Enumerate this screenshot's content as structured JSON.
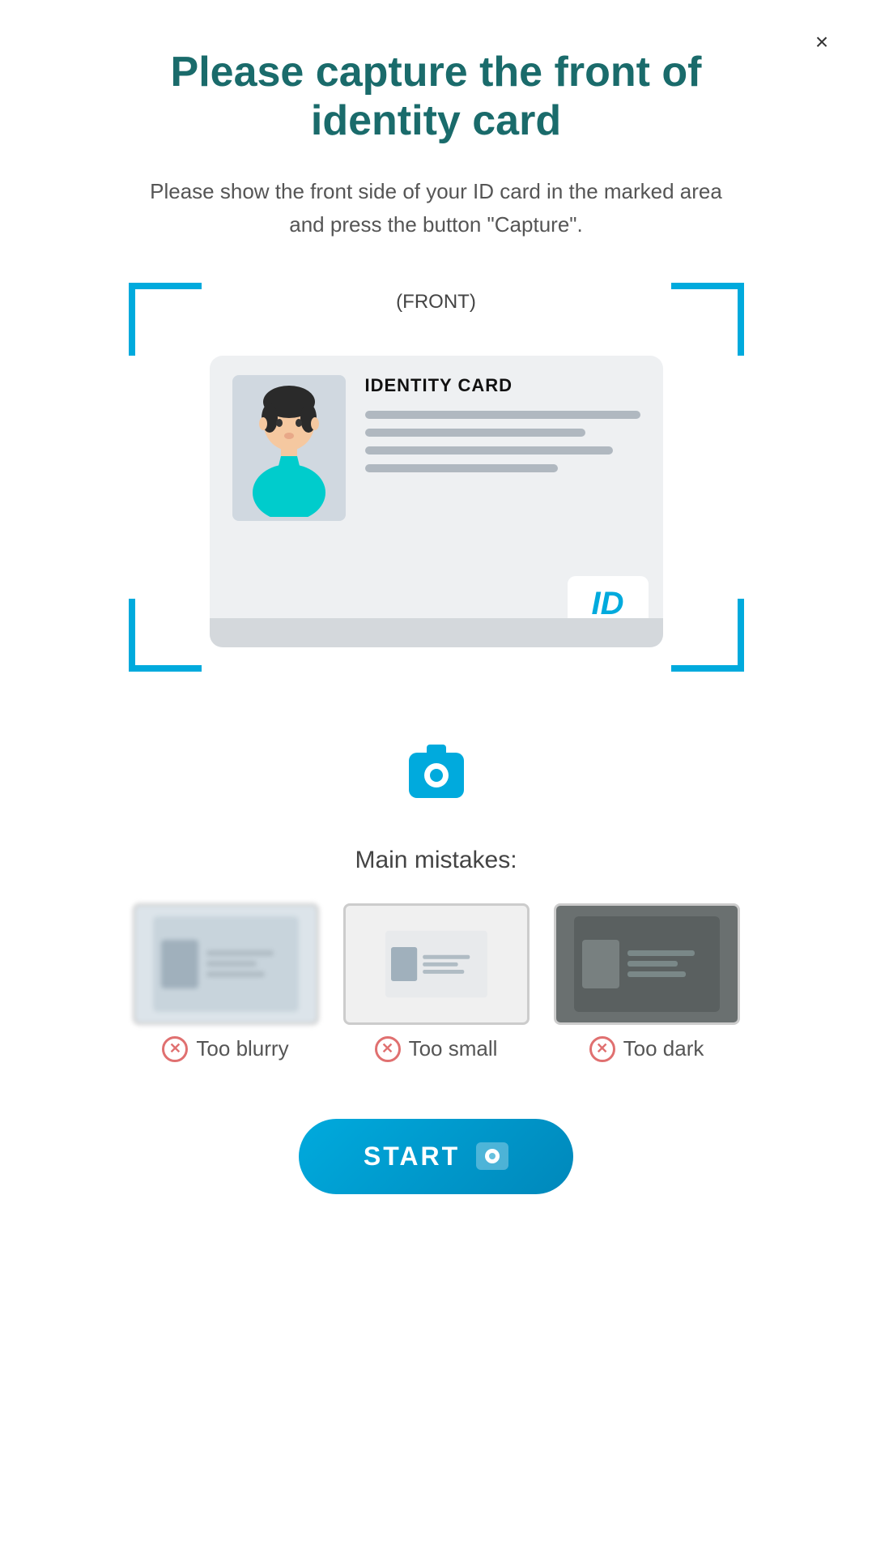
{
  "close": {
    "label": "×"
  },
  "header": {
    "title": "Please capture the front of identity card"
  },
  "subtitle": {
    "text": "Please show the front side of your ID card in the marked area and press the button \"Capture\"."
  },
  "scanner": {
    "front_label": "(FRONT)",
    "id_card_title": "IDENTITY CARD",
    "id_badge": "ID"
  },
  "mistakes": {
    "title": "Main mistakes:",
    "items": [
      {
        "label": "Too blurry",
        "type": "blurry"
      },
      {
        "label": "Too small",
        "type": "small"
      },
      {
        "label": "Too dark",
        "type": "dark"
      }
    ]
  },
  "start_button": {
    "label": "START"
  }
}
